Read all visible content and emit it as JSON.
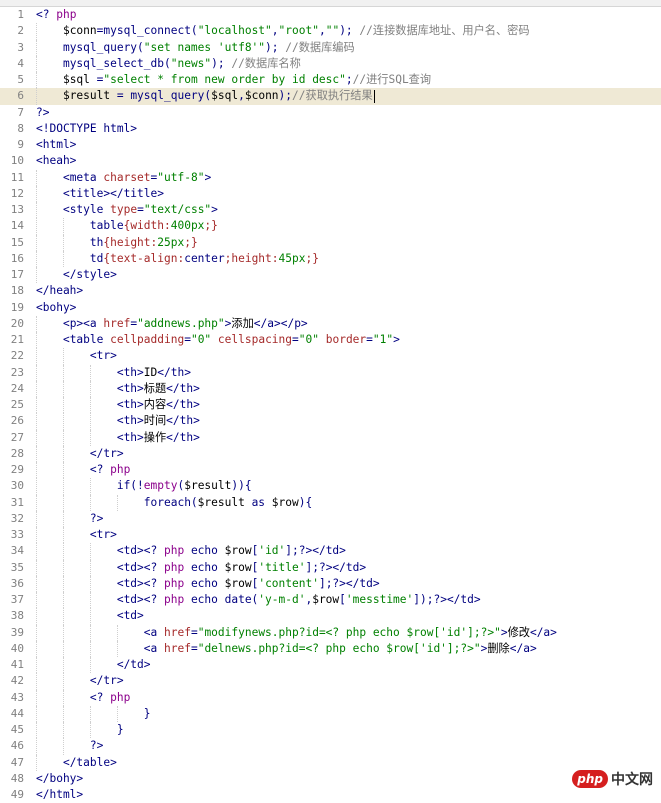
{
  "editor": {
    "current_line": 6,
    "lines": [
      {
        "n": "1",
        "tokens": [
          [
            "tag",
            "<? "
          ],
          [
            "kw",
            "php"
          ]
        ]
      },
      {
        "n": "2",
        "tokens": [
          [
            "txt",
            "    "
          ],
          [
            "var",
            "$conn"
          ],
          [
            "tag",
            "=mysql_connect("
          ],
          [
            "str",
            "\"localhost\""
          ],
          [
            "tag",
            ","
          ],
          [
            "str",
            "\"root\""
          ],
          [
            "tag",
            ","
          ],
          [
            "str",
            "\"\""
          ],
          [
            "tag",
            "); "
          ],
          [
            "cm",
            "//连接数据库地址、用户名、密码"
          ]
        ]
      },
      {
        "n": "3",
        "tokens": [
          [
            "txt",
            "    "
          ],
          [
            "tag",
            "mysql_query("
          ],
          [
            "str",
            "\"set names 'utf8'\""
          ],
          [
            "tag",
            "); "
          ],
          [
            "cm",
            "//数据库编码"
          ]
        ]
      },
      {
        "n": "4",
        "tokens": [
          [
            "txt",
            "    "
          ],
          [
            "tag",
            "mysql_select_db("
          ],
          [
            "str",
            "\"news\""
          ],
          [
            "tag",
            "); "
          ],
          [
            "cm",
            "//数据库名称"
          ]
        ]
      },
      {
        "n": "5",
        "tokens": [
          [
            "txt",
            "    "
          ],
          [
            "var",
            "$sql"
          ],
          [
            "tag",
            " ="
          ],
          [
            "str",
            "\"select * from new order by id desc\""
          ],
          [
            "tag",
            ";"
          ],
          [
            "cm",
            "//进行SQL查询"
          ]
        ]
      },
      {
        "n": "6",
        "tokens": [
          [
            "txt",
            "    "
          ],
          [
            "var",
            "$result"
          ],
          [
            "tag",
            " = mysql_query("
          ],
          [
            "var",
            "$sql"
          ],
          [
            "tag",
            ","
          ],
          [
            "var",
            "$conn"
          ],
          [
            "tag",
            ");"
          ],
          [
            "cm",
            "//获取执行结果"
          ]
        ]
      },
      {
        "n": "7",
        "tokens": [
          [
            "tag",
            "?>"
          ]
        ]
      },
      {
        "n": "8",
        "tokens": [
          [
            "tag",
            "<!DOCTYPE html>"
          ]
        ]
      },
      {
        "n": "9",
        "tokens": [
          [
            "tag",
            "<html>"
          ]
        ]
      },
      {
        "n": "10",
        "tokens": [
          [
            "tag",
            "<heah>"
          ]
        ]
      },
      {
        "n": "11",
        "tokens": [
          [
            "txt",
            "    "
          ],
          [
            "tag",
            "<meta "
          ],
          [
            "attr",
            "charset"
          ],
          [
            "tag",
            "="
          ],
          [
            "str",
            "\"utf-8\""
          ],
          [
            "tag",
            ">"
          ]
        ]
      },
      {
        "n": "12",
        "tokens": [
          [
            "txt",
            "    "
          ],
          [
            "tag",
            "<title></title>"
          ]
        ]
      },
      {
        "n": "13",
        "tokens": [
          [
            "txt",
            "    "
          ],
          [
            "tag",
            "<style "
          ],
          [
            "attr",
            "type"
          ],
          [
            "tag",
            "="
          ],
          [
            "str",
            "\"text/css\""
          ],
          [
            "tag",
            ">"
          ]
        ]
      },
      {
        "n": "14",
        "tokens": [
          [
            "txt",
            "        "
          ],
          [
            "tag",
            "table"
          ],
          [
            "attr",
            "{width:"
          ],
          [
            "str",
            "400px"
          ],
          [
            "attr",
            ";}"
          ]
        ]
      },
      {
        "n": "15",
        "tokens": [
          [
            "txt",
            "        "
          ],
          [
            "tag",
            "th"
          ],
          [
            "attr",
            "{height:"
          ],
          [
            "str",
            "25px"
          ],
          [
            "attr",
            ";}"
          ]
        ]
      },
      {
        "n": "16",
        "tokens": [
          [
            "txt",
            "        "
          ],
          [
            "tag",
            "td"
          ],
          [
            "attr",
            "{text-align:"
          ],
          [
            "tag",
            "center"
          ],
          [
            "attr",
            ";height:"
          ],
          [
            "str",
            "45px"
          ],
          [
            "attr",
            ";}"
          ]
        ]
      },
      {
        "n": "17",
        "tokens": [
          [
            "txt",
            "    "
          ],
          [
            "tag",
            "</style>"
          ]
        ]
      },
      {
        "n": "18",
        "tokens": [
          [
            "tag",
            "</heah>"
          ]
        ]
      },
      {
        "n": "19",
        "tokens": [
          [
            "tag",
            "<bohy>"
          ]
        ]
      },
      {
        "n": "20",
        "tokens": [
          [
            "txt",
            "    "
          ],
          [
            "tag",
            "<p><a "
          ],
          [
            "attr",
            "href"
          ],
          [
            "tag",
            "="
          ],
          [
            "str",
            "\"addnews.php\""
          ],
          [
            "tag",
            ">"
          ],
          [
            "txt",
            "添加"
          ],
          [
            "tag",
            "</a></p>"
          ]
        ]
      },
      {
        "n": "21",
        "tokens": [
          [
            "txt",
            "    "
          ],
          [
            "tag",
            "<table "
          ],
          [
            "attr",
            "cellpadding"
          ],
          [
            "tag",
            "="
          ],
          [
            "str",
            "\"0\""
          ],
          [
            "tag",
            " "
          ],
          [
            "attr",
            "cellspacing"
          ],
          [
            "tag",
            "="
          ],
          [
            "str",
            "\"0\""
          ],
          [
            "tag",
            " "
          ],
          [
            "attr",
            "border"
          ],
          [
            "tag",
            "="
          ],
          [
            "str",
            "\"1\""
          ],
          [
            "tag",
            ">"
          ]
        ]
      },
      {
        "n": "22",
        "tokens": [
          [
            "txt",
            "        "
          ],
          [
            "tag",
            "<tr>"
          ]
        ]
      },
      {
        "n": "23",
        "tokens": [
          [
            "txt",
            "            "
          ],
          [
            "tag",
            "<th>"
          ],
          [
            "txt",
            "ID"
          ],
          [
            "tag",
            "</th>"
          ]
        ]
      },
      {
        "n": "24",
        "tokens": [
          [
            "txt",
            "            "
          ],
          [
            "tag",
            "<th>"
          ],
          [
            "txt",
            "标题"
          ],
          [
            "tag",
            "</th>"
          ]
        ]
      },
      {
        "n": "25",
        "tokens": [
          [
            "txt",
            "            "
          ],
          [
            "tag",
            "<th>"
          ],
          [
            "txt",
            "内容"
          ],
          [
            "tag",
            "</th>"
          ]
        ]
      },
      {
        "n": "26",
        "tokens": [
          [
            "txt",
            "            "
          ],
          [
            "tag",
            "<th>"
          ],
          [
            "txt",
            "时间"
          ],
          [
            "tag",
            "</th>"
          ]
        ]
      },
      {
        "n": "27",
        "tokens": [
          [
            "txt",
            "            "
          ],
          [
            "tag",
            "<th>"
          ],
          [
            "txt",
            "操作"
          ],
          [
            "tag",
            "</th>"
          ]
        ]
      },
      {
        "n": "28",
        "tokens": [
          [
            "txt",
            "        "
          ],
          [
            "tag",
            "</tr>"
          ]
        ]
      },
      {
        "n": "29",
        "tokens": [
          [
            "txt",
            "        "
          ],
          [
            "tag",
            "<? "
          ],
          [
            "kw",
            "php"
          ]
        ]
      },
      {
        "n": "30",
        "tokens": [
          [
            "txt",
            "            "
          ],
          [
            "tag",
            "if(!"
          ],
          [
            "kw",
            "empty"
          ],
          [
            "tag",
            "("
          ],
          [
            "var",
            "$result"
          ],
          [
            "tag",
            ")){"
          ]
        ]
      },
      {
        "n": "31",
        "tokens": [
          [
            "txt",
            "                "
          ],
          [
            "tag",
            "foreach("
          ],
          [
            "var",
            "$result"
          ],
          [
            "tag",
            " as "
          ],
          [
            "var",
            "$row"
          ],
          [
            "tag",
            "){"
          ]
        ]
      },
      {
        "n": "32",
        "tokens": [
          [
            "txt",
            "        "
          ],
          [
            "tag",
            "?>"
          ]
        ]
      },
      {
        "n": "33",
        "tokens": [
          [
            "txt",
            "        "
          ],
          [
            "tag",
            "<tr>"
          ]
        ]
      },
      {
        "n": "34",
        "tokens": [
          [
            "txt",
            "            "
          ],
          [
            "tag",
            "<td><? "
          ],
          [
            "kw",
            "php"
          ],
          [
            "tag",
            " echo "
          ],
          [
            "var",
            "$row"
          ],
          [
            "tag",
            "["
          ],
          [
            "str",
            "'id'"
          ],
          [
            "tag",
            "];?></td>"
          ]
        ]
      },
      {
        "n": "35",
        "tokens": [
          [
            "txt",
            "            "
          ],
          [
            "tag",
            "<td><? "
          ],
          [
            "kw",
            "php"
          ],
          [
            "tag",
            " echo "
          ],
          [
            "var",
            "$row"
          ],
          [
            "tag",
            "["
          ],
          [
            "str",
            "'title'"
          ],
          [
            "tag",
            "];?></td>"
          ]
        ]
      },
      {
        "n": "36",
        "tokens": [
          [
            "txt",
            "            "
          ],
          [
            "tag",
            "<td><? "
          ],
          [
            "kw",
            "php"
          ],
          [
            "tag",
            " echo "
          ],
          [
            "var",
            "$row"
          ],
          [
            "tag",
            "["
          ],
          [
            "str",
            "'content'"
          ],
          [
            "tag",
            "];?></td>"
          ]
        ]
      },
      {
        "n": "37",
        "tokens": [
          [
            "txt",
            "            "
          ],
          [
            "tag",
            "<td><? "
          ],
          [
            "kw",
            "php"
          ],
          [
            "tag",
            " echo date("
          ],
          [
            "str",
            "'y-m-d'"
          ],
          [
            "tag",
            ","
          ],
          [
            "var",
            "$row"
          ],
          [
            "tag",
            "["
          ],
          [
            "str",
            "'messtime'"
          ],
          [
            "tag",
            "]);?></td>"
          ]
        ]
      },
      {
        "n": "38",
        "tokens": [
          [
            "txt",
            "            "
          ],
          [
            "tag",
            "<td>"
          ]
        ]
      },
      {
        "n": "39",
        "tokens": [
          [
            "txt",
            "                "
          ],
          [
            "tag",
            "<a "
          ],
          [
            "attr",
            "href"
          ],
          [
            "tag",
            "="
          ],
          [
            "str",
            "\"modifynews.php?id=<? php echo $row['id'];?>\""
          ],
          [
            "tag",
            ">"
          ],
          [
            "txt",
            "修改"
          ],
          [
            "tag",
            "</a>"
          ]
        ]
      },
      {
        "n": "40",
        "tokens": [
          [
            "txt",
            "                "
          ],
          [
            "tag",
            "<a "
          ],
          [
            "attr",
            "href"
          ],
          [
            "tag",
            "="
          ],
          [
            "str",
            "\"delnews.php?id=<? php echo $row['id'];?>\""
          ],
          [
            "tag",
            ">"
          ],
          [
            "txt",
            "删除"
          ],
          [
            "tag",
            "</a>"
          ]
        ]
      },
      {
        "n": "41",
        "tokens": [
          [
            "txt",
            "            "
          ],
          [
            "tag",
            "</td>"
          ]
        ]
      },
      {
        "n": "42",
        "tokens": [
          [
            "txt",
            "        "
          ],
          [
            "tag",
            "</tr>"
          ]
        ]
      },
      {
        "n": "43",
        "tokens": [
          [
            "txt",
            "        "
          ],
          [
            "tag",
            "<? "
          ],
          [
            "kw",
            "php"
          ]
        ]
      },
      {
        "n": "44",
        "tokens": [
          [
            "txt",
            "                "
          ],
          [
            "tag",
            "}"
          ]
        ]
      },
      {
        "n": "45",
        "tokens": [
          [
            "txt",
            "            "
          ],
          [
            "tag",
            "}"
          ]
        ]
      },
      {
        "n": "46",
        "tokens": [
          [
            "txt",
            "        "
          ],
          [
            "tag",
            "?>"
          ]
        ]
      },
      {
        "n": "47",
        "tokens": [
          [
            "txt",
            "    "
          ],
          [
            "tag",
            "</table>"
          ]
        ]
      },
      {
        "n": "48",
        "tokens": [
          [
            "tag",
            "</bohy>"
          ]
        ]
      },
      {
        "n": "49",
        "tokens": [
          [
            "tag",
            "</html>"
          ]
        ]
      }
    ]
  },
  "watermark": {
    "logo": "php",
    "text": "中文网"
  }
}
